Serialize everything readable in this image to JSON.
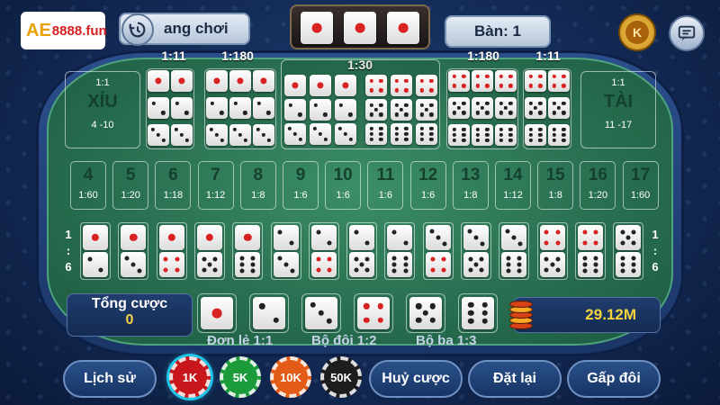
{
  "logo_text": "8888.fun",
  "header": {
    "status_label": "ang chơi",
    "table_label": "Bàn: 1",
    "coin_letter": "K",
    "last_roll": [
      1,
      1,
      1
    ]
  },
  "odds": {
    "o1": "1:11",
    "o2": "1:180",
    "o3": "1:30",
    "o4": "1:180",
    "o5": "1:11"
  },
  "big_small": {
    "small": {
      "odds": "1:1",
      "name": "XỈU",
      "range": "4 -10"
    },
    "big": {
      "odds": "1:1",
      "name": "TÀI",
      "range": "11 -17"
    }
  },
  "sums": [
    {
      "n": "4",
      "o": "1:60"
    },
    {
      "n": "5",
      "o": "1:20"
    },
    {
      "n": "6",
      "o": "1:18"
    },
    {
      "n": "7",
      "o": "1:12"
    },
    {
      "n": "8",
      "o": "1:8"
    },
    {
      "n": "9",
      "o": "1:6"
    },
    {
      "n": "10",
      "o": "1:6"
    },
    {
      "n": "11",
      "o": "1:6"
    },
    {
      "n": "12",
      "o": "1:6"
    },
    {
      "n": "13",
      "o": "1:8"
    },
    {
      "n": "14",
      "o": "1:12"
    },
    {
      "n": "15",
      "o": "1:8"
    },
    {
      "n": "16",
      "o": "1:20"
    },
    {
      "n": "17",
      "o": "1:60"
    }
  ],
  "combo_side": {
    "left_top": "1",
    "left_colon": ":",
    "left_bottom": "6",
    "right_top": "1",
    "right_colon": ":",
    "right_bottom": "6"
  },
  "bottom": {
    "total_label": "Tổng cược",
    "total_value": "0",
    "balance": "29.12M",
    "legend_single": "Đơn lẻ 1:1",
    "legend_double": "Bộ đôi 1:2",
    "legend_triple": "Bộ ba 1:3"
  },
  "actions": {
    "history": "Lịch sử",
    "cancel": "Huỷ cược",
    "reset": "Đặt lại",
    "double": "Gấp đôi"
  },
  "chips": [
    {
      "label": "1K",
      "color": "#c8161d"
    },
    {
      "label": "5K",
      "color": "#1b9b3a"
    },
    {
      "label": "10K",
      "color": "#e25b17"
    },
    {
      "label": "50K",
      "color": "#1d1d1d"
    }
  ]
}
